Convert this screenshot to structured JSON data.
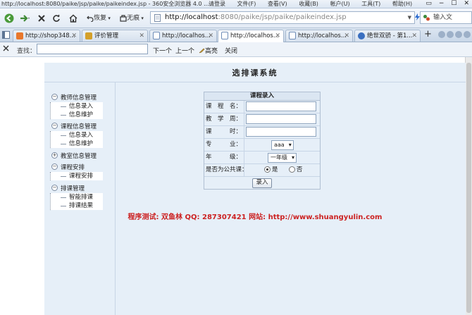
{
  "window": {
    "title": "http://localhost:8080/paike/jsp/paike/paikeindex.jsp - 360安全浏览器 4.0 ...",
    "login": "请登录",
    "menus": [
      "文件(F)",
      "查看(V)",
      "收藏(B)",
      "帐户(U)",
      "工具(T)",
      "帮助(H)"
    ],
    "controls": [
      "▭",
      "−",
      "☐",
      "✕"
    ]
  },
  "navbar": {
    "restore_label": "恢复",
    "ad_label": "无痕",
    "url_host": "http://localhost",
    "url_rest": ":8080/paike/jsp/paike/paikeindex.jsp",
    "speedup_label": "加速",
    "search_placeholder": "输入文"
  },
  "tabs": [
    {
      "label": "http://shop348...",
      "active": false,
      "color": "#e8772c"
    },
    {
      "label": "评价管理",
      "active": false,
      "color": "#d4a02a"
    },
    {
      "label": "http://localhos...",
      "active": false,
      "color": "#6d8cb7"
    },
    {
      "label": "http://localhos...",
      "active": true,
      "color": "#6d8cb7"
    },
    {
      "label": "http://localhos...",
      "active": false,
      "color": "#6d8cb7"
    },
    {
      "label": "绝世双骄 - 第1...",
      "active": false,
      "color": "#3a6fc0"
    }
  ],
  "findbar": {
    "label": "查找：",
    "value": "",
    "next": "下一个",
    "prev": "上一个",
    "highlight": "高亮",
    "close": "关闭"
  },
  "page": {
    "title": "选排课系统",
    "sidebar": [
      {
        "label": "教师信息管理",
        "items": [
          "信息录入",
          "信息维护"
        ]
      },
      {
        "label": "课程信息管理",
        "items": [
          "信息录入",
          "信息维护"
        ]
      },
      {
        "label": "教室信息管理",
        "items": []
      },
      {
        "label": "课程安排",
        "items": [
          "课程安排"
        ]
      },
      {
        "label": "排课管理",
        "items": [
          "智能排课",
          "排课结果"
        ]
      }
    ],
    "form": {
      "heading": "课程录入",
      "name_label": "课　程　名：",
      "name_value": "",
      "week_label": "教　学　周：",
      "week_value": "",
      "hours_label": "课　　　时：",
      "hours_value": "",
      "major_label": "专　　　业：",
      "major_value": "aaa",
      "grade_label": "年　　　级：",
      "grade_value": "一年级",
      "public_label": "是否为公共课：",
      "yes_label": "是",
      "no_label": "否",
      "public_selected": "是",
      "submit_label": "录入"
    },
    "footer": "程序测试: 双鱼林  QQ: 287307421  网站: http://www.shuangyulin.com"
  }
}
